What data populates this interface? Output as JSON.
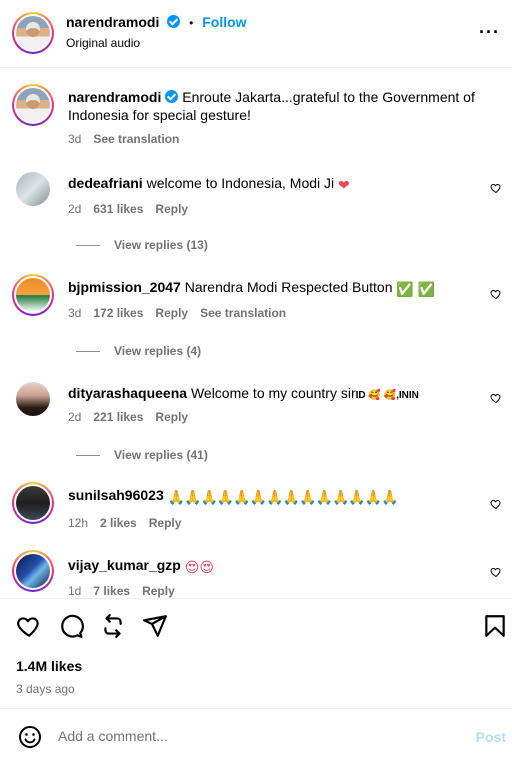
{
  "header": {
    "username": "narendramodi",
    "separator": "•",
    "follow_label": "Follow",
    "audio": "Original audio",
    "more_icon": "ellipsis-icon"
  },
  "caption": {
    "username": "narendramodi",
    "text": "Enroute Jakarta...grateful to the Government of Indonesia for special gesture!",
    "time": "3d",
    "translate_label": "See translation"
  },
  "comments": [
    {
      "username": "dedeafriani",
      "text": "welcome to Indonesia, Modi Ji",
      "emoji": "❤",
      "time": "2d",
      "likes": "631 likes",
      "reply": "Reply",
      "view_replies": "View replies (13)"
    },
    {
      "username": "bjpmission_2047",
      "text": "Narendra Modi Respected Button",
      "emoji": "✅ ✅",
      "time": "3d",
      "likes": "172 likes",
      "reply": "Reply",
      "translate": "See translation",
      "view_replies": "View replies (4)"
    },
    {
      "username": "dityarashaqueena",
      "text": "Welcome to my country sir",
      "suffix": "ID 🥰 🥰,ININ",
      "time": "2d",
      "likes": "221 likes",
      "reply": "Reply",
      "view_replies": "View replies (41)"
    },
    {
      "username": "sunilsah96023",
      "text": "",
      "emoji": "🙏🙏🙏🙏🙏🙏🙏🙏🙏🙏🙏🙏🙏🙏",
      "time": "12h",
      "likes": "2 likes",
      "reply": "Reply"
    },
    {
      "username": "vijay_kumar_gzp",
      "text": "",
      "emoji": "😍😍",
      "time": "1d",
      "likes": "7 likes",
      "reply": "Reply"
    }
  ],
  "actions": {
    "like_icon": "heart-icon",
    "comment_icon": "comment-icon",
    "share_icon": "repost-icon",
    "send_icon": "send-icon",
    "save_icon": "bookmark-icon"
  },
  "likes_count": "1.4M likes",
  "posted_ago": "3 days ago",
  "add_comment": {
    "placeholder": "Add a comment...",
    "post_label": "Post"
  },
  "colors": {
    "accent": "#0095f6",
    "muted": "#737373",
    "post_disabled": "#b2dffc",
    "heart": "#ed4956"
  }
}
